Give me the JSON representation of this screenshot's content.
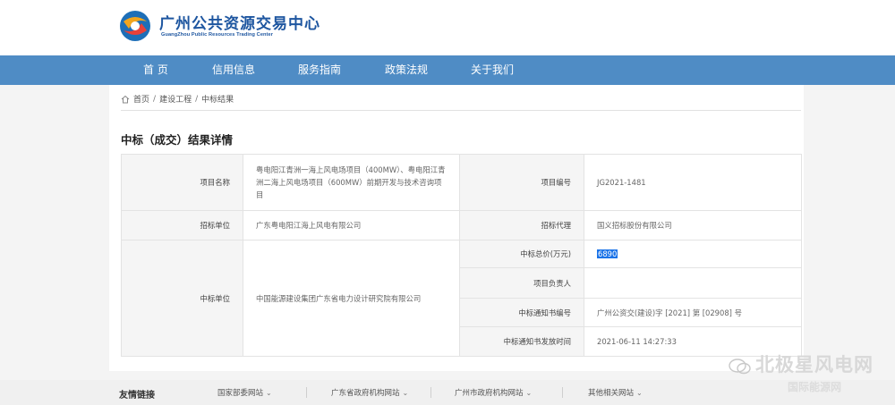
{
  "site": {
    "title": "广州公共资源交易中心",
    "subtitle": "GuangZhou Public Resources Trading Center"
  },
  "nav": {
    "items": [
      {
        "label": "首 页"
      },
      {
        "label": "信用信息"
      },
      {
        "label": "服务指南"
      },
      {
        "label": "政策法规"
      },
      {
        "label": "关于我们"
      }
    ]
  },
  "breadcrumb": {
    "items": [
      "首页",
      "建设工程",
      "中标结果"
    ],
    "separator": "/"
  },
  "page": {
    "title": "中标（成交）结果详情"
  },
  "details": {
    "project_name_label": "项目名称",
    "project_name": "粤电阳江青洲一海上风电场项目（400MW）、粤电阳江青洲二海上风电场项目（600MW）前期开发与技术咨询项目",
    "project_no_label": "项目编号",
    "project_no": "JG2021-1481",
    "tenderer_label": "招标单位",
    "tenderer": "广东粤电阳江海上风电有限公司",
    "agent_label": "招标代理",
    "agent": "国义招标股份有限公司",
    "winner_label": "中标单位",
    "winner": "中国能源建设集团广东省电力设计研究院有限公司",
    "price_label": "中标总价(万元)",
    "price": "6890",
    "manager_label": "项目负责人",
    "manager": "",
    "notice_no_label": "中标通知书编号",
    "notice_no": "广州公资交(建设)字 [2021] 第 [02908] 号",
    "notice_time_label": "中标通知书发放时间",
    "notice_time": "2021-06-11 14:27:33"
  },
  "footer": {
    "title": "友情链接",
    "links": [
      "国家部委网站",
      "广东省政府机构网站",
      "广州市政府机构网站",
      "其他相关网站"
    ]
  },
  "watermark": {
    "text": "北极星风电网",
    "sub": "国际能源网"
  },
  "colors": {
    "brand": "#1e56a0",
    "nav": "#4f8cc5",
    "selection": "#1a73e8"
  }
}
